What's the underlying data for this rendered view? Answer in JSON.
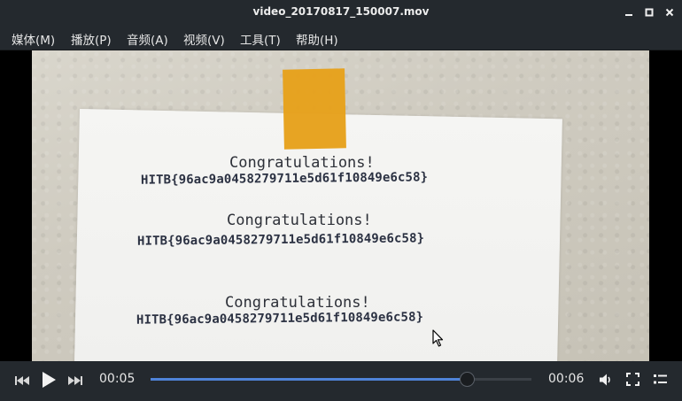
{
  "window": {
    "title": "video_20170817_150007.mov"
  },
  "menu": {
    "items": [
      {
        "label": "媒体(M)"
      },
      {
        "label": "播放(P)"
      },
      {
        "label": "音频(A)"
      },
      {
        "label": "视频(V)"
      },
      {
        "label": "工具(T)"
      },
      {
        "label": "帮助(H)"
      }
    ]
  },
  "video": {
    "lines": [
      {
        "congrats": "Congratulations!",
        "flag": "HITB{96ac9a0458279711e5d61f10849e6c58}"
      },
      {
        "congrats": "Congratulations!",
        "flag": "HITB{96ac9a0458279711e5d61f10849e6c58}"
      },
      {
        "congrats": "Congratulations!",
        "flag": "HITB{96ac9a0458279711e5d61f10849e6c58}"
      }
    ]
  },
  "controls": {
    "time_elapsed": "00:05",
    "time_total": "00:06",
    "progress_fraction": 0.83
  },
  "colors": {
    "seek_fill": "#4f83d8",
    "chrome_bg": "#24292e",
    "tape": "#e6a11c"
  },
  "icons": {
    "minimize": "minimize-icon",
    "maximize": "maximize-icon",
    "close": "close-icon",
    "prev": "skip-previous-icon",
    "play": "play-icon",
    "next": "skip-next-icon",
    "volume": "volume-icon",
    "fullscreen": "fullscreen-icon",
    "playlist": "playlist-icon"
  }
}
